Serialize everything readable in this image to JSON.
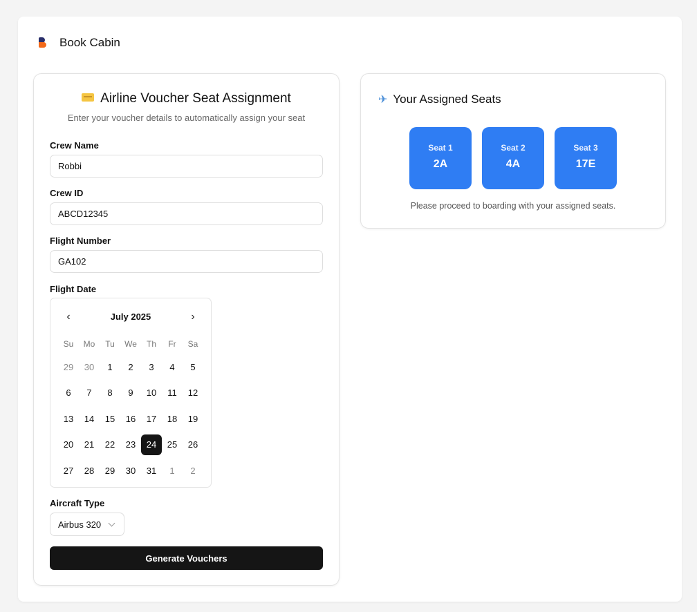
{
  "brand": {
    "name": "Book Cabin"
  },
  "form": {
    "icon": "ticket-icon",
    "title": "Airline Voucher Seat Assignment",
    "subtitle": "Enter your voucher details to automatically assign your seat",
    "crew_name": {
      "label": "Crew Name",
      "value": "Robbi"
    },
    "crew_id": {
      "label": "Crew ID",
      "value": "ABCD12345"
    },
    "flight_number": {
      "label": "Flight Number",
      "value": "GA102"
    },
    "flight_date": {
      "label": "Flight Date",
      "month_label": "July 2025",
      "prev_icon": "chevron-left-icon",
      "next_icon": "chevron-right-icon",
      "weekdays": [
        "Su",
        "Mo",
        "Tu",
        "We",
        "Th",
        "Fr",
        "Sa"
      ],
      "days": [
        {
          "d": "29",
          "outside": true
        },
        {
          "d": "30",
          "outside": true
        },
        {
          "d": "1"
        },
        {
          "d": "2"
        },
        {
          "d": "3"
        },
        {
          "d": "4"
        },
        {
          "d": "5"
        },
        {
          "d": "6"
        },
        {
          "d": "7"
        },
        {
          "d": "8"
        },
        {
          "d": "9"
        },
        {
          "d": "10"
        },
        {
          "d": "11"
        },
        {
          "d": "12"
        },
        {
          "d": "13"
        },
        {
          "d": "14"
        },
        {
          "d": "15"
        },
        {
          "d": "16"
        },
        {
          "d": "17"
        },
        {
          "d": "18"
        },
        {
          "d": "19"
        },
        {
          "d": "20"
        },
        {
          "d": "21"
        },
        {
          "d": "22"
        },
        {
          "d": "23"
        },
        {
          "d": "24",
          "selected": true
        },
        {
          "d": "25"
        },
        {
          "d": "26"
        },
        {
          "d": "27"
        },
        {
          "d": "28"
        },
        {
          "d": "29"
        },
        {
          "d": "30"
        },
        {
          "d": "31"
        },
        {
          "d": "1",
          "outside": true
        },
        {
          "d": "2",
          "outside": true
        }
      ]
    },
    "aircraft_type": {
      "label": "Aircraft Type",
      "value": "Airbus 320",
      "icon": "chevron-down-icon"
    },
    "submit_label": "Generate Vouchers"
  },
  "seats": {
    "icon": "airplane-icon",
    "title": "Your Assigned Seats",
    "items": [
      {
        "label": "Seat 1",
        "code": "2A"
      },
      {
        "label": "Seat 2",
        "code": "4A"
      },
      {
        "label": "Seat 3",
        "code": "17E"
      }
    ],
    "note": "Please proceed to boarding with your assigned seats."
  },
  "colors": {
    "primary_button": "#151515",
    "seat_card": "#2f7df3",
    "selected_day": "#151515",
    "brand_orange": "#f26a1b",
    "brand_navy": "#2a2f6b"
  }
}
